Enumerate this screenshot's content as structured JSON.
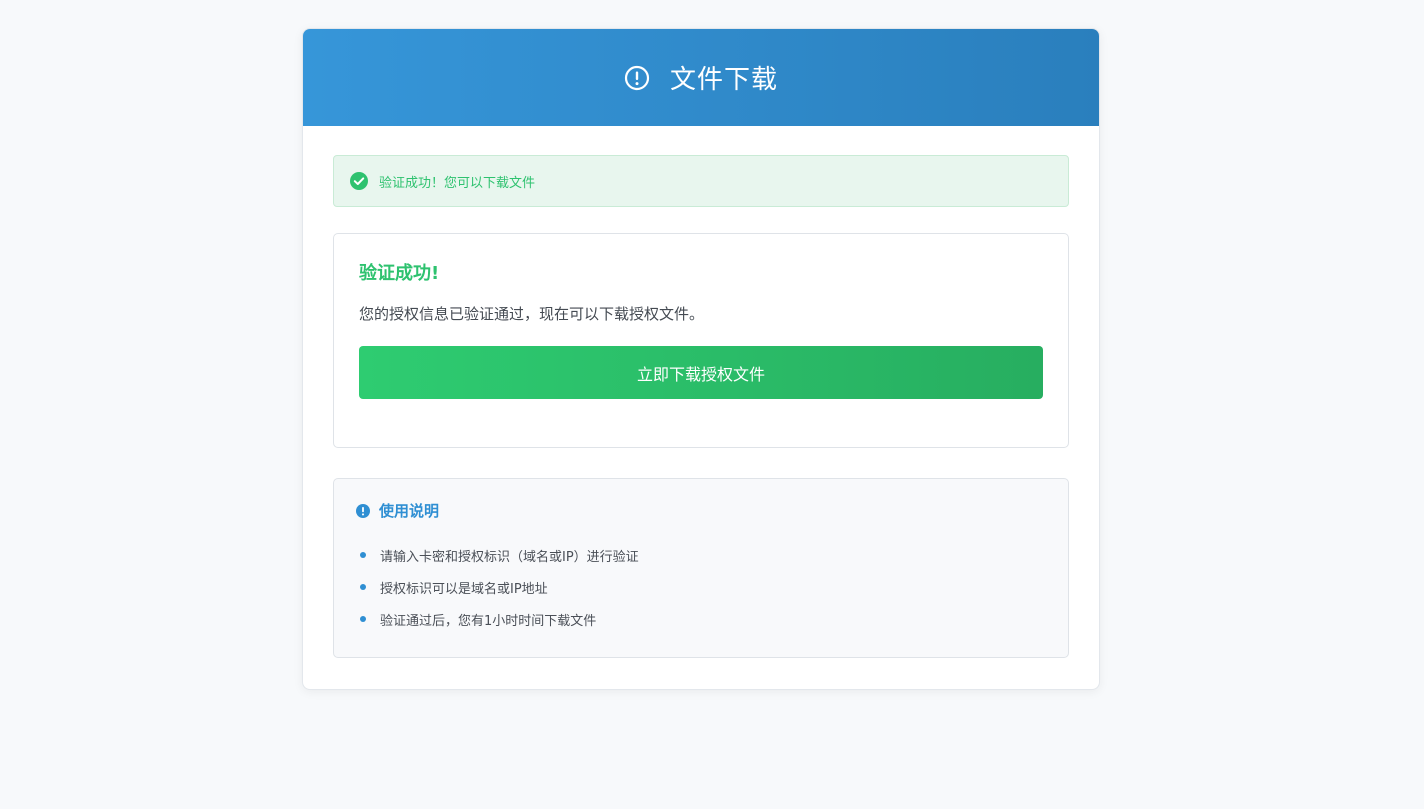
{
  "header": {
    "title": "文件下载",
    "icon": "alert-circle-icon"
  },
  "alert": {
    "icon": "check-circle-icon",
    "message": "验证成功！您可以下载文件"
  },
  "result": {
    "title": "验证成功!",
    "description": "您的授权信息已验证通过，现在可以下载授权文件。",
    "download_label": "立即下载授权文件"
  },
  "usage": {
    "icon": "info-circle-icon",
    "title": "使用说明",
    "items": [
      "请输入卡密和授权标识（域名或IP）进行验证",
      "授权标识可以是域名或IP地址",
      "验证通过后，您有1小时时间下载文件"
    ]
  },
  "colors": {
    "header_start": "#3696d9",
    "header_end": "#2a7fbd",
    "success": "#2ec26f",
    "info": "#2f8fd3"
  }
}
